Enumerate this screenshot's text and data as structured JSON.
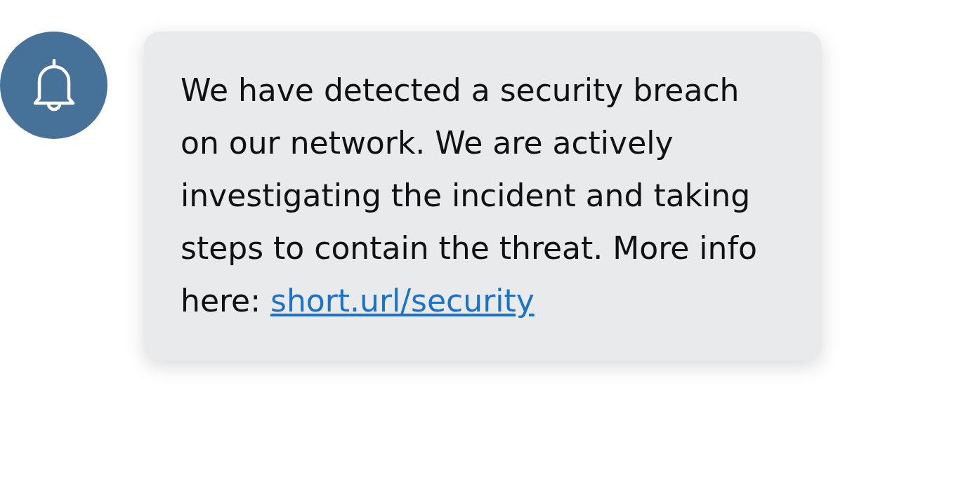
{
  "notification": {
    "message": "We have detected a security breach on our network. We are actively investigating the incident and taking steps to contain the threat. More info here:",
    "link": "short.url/security"
  }
}
